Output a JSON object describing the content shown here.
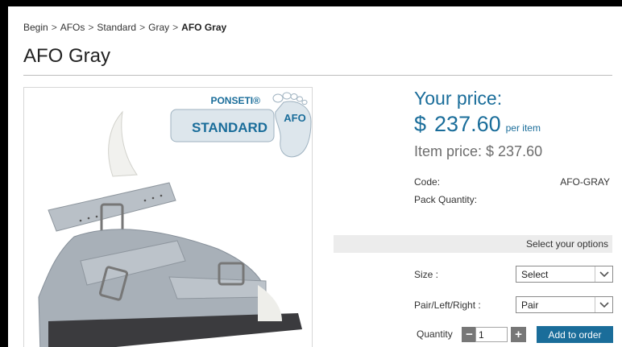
{
  "breadcrumb": {
    "items": [
      "Begin",
      "AFOs",
      "Standard",
      "Gray"
    ],
    "separator": ">",
    "current": "AFO Gray"
  },
  "page_title": "AFO Gray",
  "product_image": {
    "logo_top": "PONSETI®",
    "logo_main": "STANDARD",
    "logo_badge": "AFO"
  },
  "pricing": {
    "your_price_label": "Your price:",
    "currency": "$",
    "amount": "237.60",
    "unit": "per item",
    "item_price": "Item price: $ 237.60"
  },
  "details": {
    "code_label": "Code:",
    "code_value": "AFO-GRAY",
    "pack_label": "Pack Quantity:"
  },
  "options": {
    "header": "Select your options",
    "size_label": "Size :",
    "size_value": "Select",
    "side_label": "Pair/Left/Right :",
    "side_value": "Pair"
  },
  "order": {
    "quantity_label": "Quantity",
    "quantity_value": "1",
    "minus": "−",
    "plus": "+",
    "add_label": "Add to order"
  },
  "colors": {
    "accent": "#1a6d9a",
    "muted": "#6d6d6d",
    "options_bar": "#ececec"
  }
}
